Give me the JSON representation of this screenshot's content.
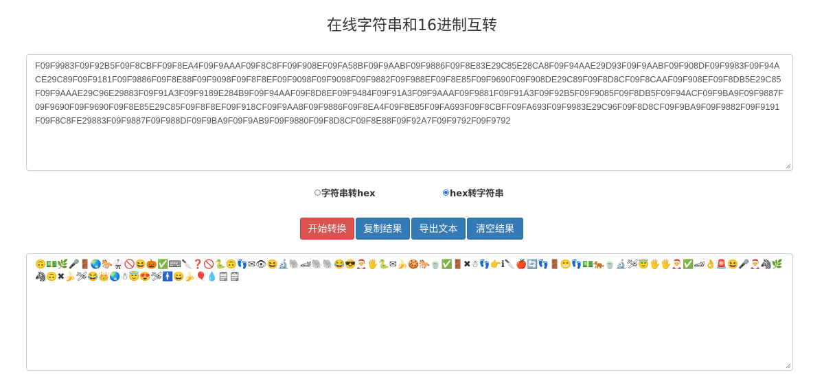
{
  "page": {
    "title": "在线字符串和16进制互转"
  },
  "input": {
    "value": "F09F9983F09F92B5F09F8CBFF09F8EA4F09F9AAAF09F8C8FF09F908EF09FA58BF09F9AABF09F9886F09F8E83E29C85E28CA8F09F94AAE29D93F09F9AABF09F908DF09F9983F09F94ACE29C89F09F9181F09F9886F09F8E88F09F9098F09F8F8EF09F9098F09F9098F09F9882F09F988EF09F8E85F09F9690F09F908DE29C89F09F8D8CF09F8CAAF09F908EF09F8DB5E29C85F09F9AAAE29C96E29883F09F91A3F09F9189E284B9F09F94AAF09F8D8EF09F9484F09F91A3F09F9AAAF09F9881F09F91A3F09F92B5F09F9085F09F8DB5F09F94ACF09F9BA9F09F9887F09F9690F09F9690F09F8E85E29C85F09F8F8EF09F918CF09F9AA8F09F9886F09F8EA4F09F8E85F09FA693F09F8CBFF09FA693F09F9983E29C96F09F8D8CF09F9BA9F09F9882F09F9191F09F8C8FE29883F09F9887F09F988DF09F9BA9F09F9AB9F09F9880F09F8D8CF09F8E88F09F92A7F09F9792F09F9792"
  },
  "options": {
    "str_to_hex": "字符串转hex",
    "hex_to_str": "hex转字符串",
    "selected": "hex_to_str"
  },
  "buttons": {
    "start": "开始转换",
    "copy": "复制结果",
    "export": "导出文本",
    "clear": "清空结果"
  },
  "colors": {
    "start_button": "#d9534f",
    "action_button": "#337ab7",
    "radio_accent": "#2b6fdc"
  },
  "output": {
    "value": "🙃💵🌿🎤🚪🌏🐎🥋🚫😆🎃✅⌨🔪❓🚫🐍🙃👣✉👁😆🔬🐘🏎🐘🐘😂😎🎅🖐🐍✉🍌🍪🐎🍵✅🚪✖☃👣👉ℹ🔪🍎🔄👣🚪😁👣💵🐅🍵🔬🛩😇🖐🖐🎅✅🏎👌🚨😆🎤🎅🦓🌿🦓🙃✖🍌🛩😂👑🌏☃😇😍🛩🚹😀🍌🎈💧🗒🗒"
  }
}
